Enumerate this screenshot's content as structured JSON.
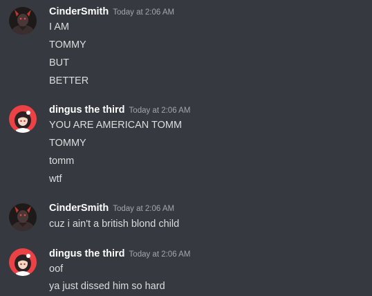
{
  "colors": {
    "background": "#36393f",
    "username": "#ffffff",
    "timestamp": "#a3a6aa",
    "message_text": "#dcddde",
    "avatar_cinder_bg": "#1e1a1a",
    "avatar_dingus_bg": "#ed4245"
  },
  "messages": [
    {
      "author": "CinderSmith",
      "timestamp": "Today at 2:06 AM",
      "avatar_icon": "demon-avatar-icon",
      "lines": [
        "I AM",
        "TOMMY",
        "BUT",
        "BETTER"
      ]
    },
    {
      "author": "dingus the third",
      "timestamp": "Today at 2:06 AM",
      "avatar_icon": "anime-girl-avatar-icon",
      "lines": [
        "YOU ARE AMERICAN TOMM",
        "TOMMY",
        "tomm",
        "wtf"
      ]
    },
    {
      "author": "CinderSmith",
      "timestamp": "Today at 2:06 AM",
      "avatar_icon": "demon-avatar-icon",
      "lines": [
        "cuz i ain't a british blond child"
      ]
    },
    {
      "author": "dingus the third",
      "timestamp": "Today at 2:06 AM",
      "avatar_icon": "anime-girl-avatar-icon",
      "lines": [
        "oof",
        "ya just dissed him so hard"
      ]
    }
  ]
}
